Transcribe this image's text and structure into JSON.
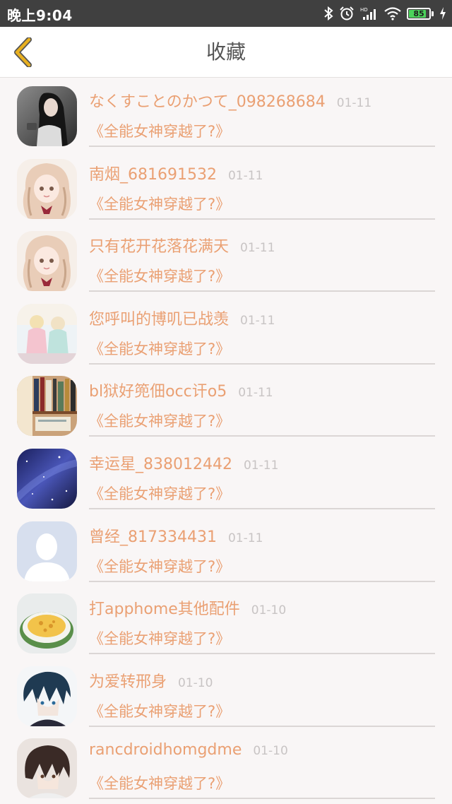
{
  "status_bar": {
    "time": "晚上9:04",
    "battery_level": "85",
    "battery_color": "#4cd35b"
  },
  "header": {
    "title": "收藏",
    "back_icon": "chevron-left-icon",
    "accent": "#e8b020"
  },
  "favorites": [
    {
      "user": "なくすことのかつて_098268684",
      "date": "01-11",
      "title": "《全能女神穿越了?》",
      "avatar": "girl-photo"
    },
    {
      "user": "南烟_681691532",
      "date": "01-11",
      "title": "《全能女神穿越了?》",
      "avatar": "anime-girl"
    },
    {
      "user": "只有花开花落花满天",
      "date": "01-11",
      "title": "《全能女神穿越了?》",
      "avatar": "anime-girl"
    },
    {
      "user": "您呼叫的博叽已战羡",
      "date": "01-11",
      "title": "《全能女神穿越了?》",
      "avatar": "dolls-photo"
    },
    {
      "user": "bl狱好篼佃occ讦o5",
      "date": "01-11",
      "title": "《全能女神穿越了?》",
      "avatar": "bookshelf-photo"
    },
    {
      "user": "幸运星_838012442",
      "date": "01-11",
      "title": "《全能女神穿越了?》",
      "avatar": "starry-sky"
    },
    {
      "user": "曾经_817334431",
      "date": "01-11",
      "title": "《全能女神穿越了?》",
      "avatar": "default-person"
    },
    {
      "user": "打apphome其他配件",
      "date": "01-10",
      "title": "《全能女神穿越了?》",
      "avatar": "food-bowl"
    },
    {
      "user": "为爱转邢身",
      "date": "01-10",
      "title": "《全能女神穿越了?》",
      "avatar": "anime-boy-blue"
    },
    {
      "user": "rancdroidhomgdme",
      "date": "01-10",
      "title": "《全能女神穿越了?》",
      "avatar": "anime-boy-brown"
    }
  ]
}
